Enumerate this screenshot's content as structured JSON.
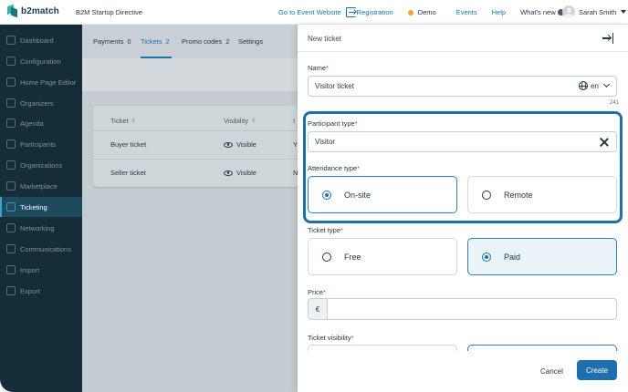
{
  "topbar": {
    "logo_text": "b2match",
    "event_name": "B2M Startup Directive",
    "go_to_website": "Go to Event Website",
    "registration": "Registration",
    "demo": "Demo",
    "events": "Events",
    "help": "Help",
    "whats_new": "What's new",
    "user_name": "Sarah Smith"
  },
  "sidebar": {
    "items": [
      {
        "label": "Dashboard",
        "icon": "dashboard-icon"
      },
      {
        "label": "Configuration",
        "icon": "configuration-icon"
      },
      {
        "label": "Home Page Editor",
        "icon": "home-page-editor-icon"
      },
      {
        "label": "Organizers",
        "icon": "organizers-icon"
      },
      {
        "label": "Agenda",
        "icon": "agenda-icon"
      },
      {
        "label": "Participants",
        "icon": "participants-icon"
      },
      {
        "label": "Organizations",
        "icon": "organizations-icon"
      },
      {
        "label": "Marketplace",
        "icon": "marketplace-icon"
      },
      {
        "label": "Ticketing",
        "icon": "ticketing-icon",
        "active": true
      },
      {
        "label": "Networking",
        "icon": "networking-icon"
      },
      {
        "label": "Communications",
        "icon": "communications-icon"
      },
      {
        "label": "Import",
        "icon": "import-icon"
      },
      {
        "label": "Export",
        "icon": "export-icon"
      }
    ]
  },
  "main": {
    "tabs": [
      {
        "label": "Payments",
        "count": "0"
      },
      {
        "label": "Tickets",
        "count": "2",
        "active": true
      },
      {
        "label": "Promo codes",
        "count": "2"
      },
      {
        "label": "Settings",
        "count": ""
      }
    ],
    "table": {
      "columns": [
        "Ticket",
        "Visibility",
        "I"
      ],
      "rows": [
        {
          "ticket": "Buyer ticket",
          "visibility": "Visible",
          "extra": "Y"
        },
        {
          "ticket": "Seller ticket",
          "visibility": "Visible",
          "extra": "N"
        }
      ]
    }
  },
  "drawer": {
    "title": "New ticket",
    "name": {
      "label": "Name",
      "value": "Visitor ticket",
      "lang": "en",
      "counter": "241"
    },
    "participant_type": {
      "label": "Participant type",
      "value": "Visitor"
    },
    "attendance_type": {
      "label": "Attendance type",
      "options": [
        "On-site",
        "Remote"
      ],
      "selected": "On-site"
    },
    "ticket_type": {
      "label": "Ticket type",
      "options": [
        "Free",
        "Paid"
      ],
      "selected": "Paid"
    },
    "price": {
      "label": "Price",
      "currency": "€",
      "value": ""
    },
    "ticket_visibility": {
      "label": "Ticket visibility"
    },
    "cancel": "Cancel",
    "create": "Create",
    "required_mark": "*"
  },
  "colors": {
    "sidebar_bg": "#142d38",
    "accent": "#1f6fae",
    "highlight_border": "#1b72a8",
    "required": "#d84040"
  }
}
